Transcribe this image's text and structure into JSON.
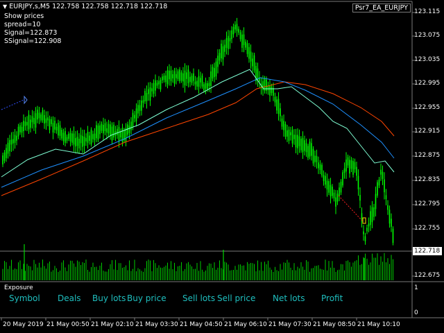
{
  "chart": {
    "symbol_line": "EURJPY,s,M5  122.758 122.758 122.718 122.718",
    "info": [
      "Show prices",
      "spread=10",
      "Signal=122.873",
      "SSignal=122.908"
    ],
    "ea_name": "Psr7_EA_EURJPY",
    "current_price": "122.718",
    "price_scale": [
      "123.115",
      "123.075",
      "123.035",
      "122.995",
      "122.955",
      "122.915",
      "122.875",
      "122.835",
      "122.795",
      "122.755",
      "122.675"
    ],
    "time_axis": [
      "20 May 2019",
      "21 May 00:50",
      "21 May 02:10",
      "21 May 03:30",
      "21 May 04:50",
      "21 May 06:10",
      "21 May 07:30",
      "21 May 08:50",
      "21 May 10:10"
    ],
    "colors": {
      "bull": "#00ff00",
      "bear": "#00ff00",
      "ma_fast": "#7fffd4",
      "ma_mid": "#1e90ff",
      "ma_slow": "#ff4500",
      "volume": "#00ff00",
      "grid": "#7a7a7a"
    }
  },
  "exposure": {
    "title": "Exposure",
    "subwindow_scale": [
      "1",
      "0"
    ],
    "columns": [
      "Symbol",
      "Deals",
      "Buy lots",
      "Buy price",
      "Sell lots",
      "Sell price",
      "Net lots",
      "Profit"
    ]
  }
}
